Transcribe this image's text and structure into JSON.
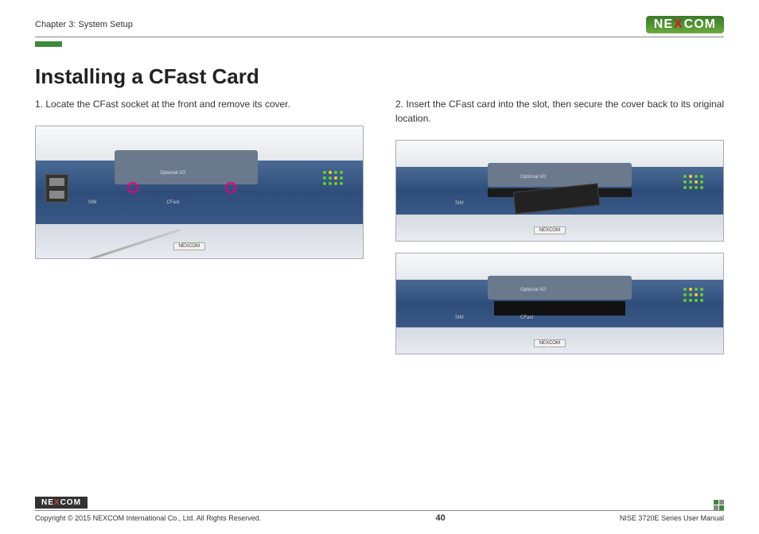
{
  "header": {
    "chapter": "Chapter 3: System Setup",
    "logo_text_1": "NE",
    "logo_text_x": "X",
    "logo_text_2": "COM"
  },
  "main": {
    "title": "Installing a CFast Card",
    "step1": "1. Locate the CFast socket at the front and remove its cover.",
    "step2": "2. Insert the CFast card into the slot, then secure the cover back to its original location."
  },
  "device": {
    "optional_io": "Optional I/O",
    "sim": "SIM",
    "cfast": "CFast",
    "brand": "NEXCOM"
  },
  "footer": {
    "logo_text_1": "NE",
    "logo_text_x": "X",
    "logo_text_2": "COM",
    "copyright": "Copyright © 2015 NEXCOM International Co., Ltd. All Rights Reserved.",
    "page": "40",
    "manual": "NISE 3720E Series User Manual"
  }
}
